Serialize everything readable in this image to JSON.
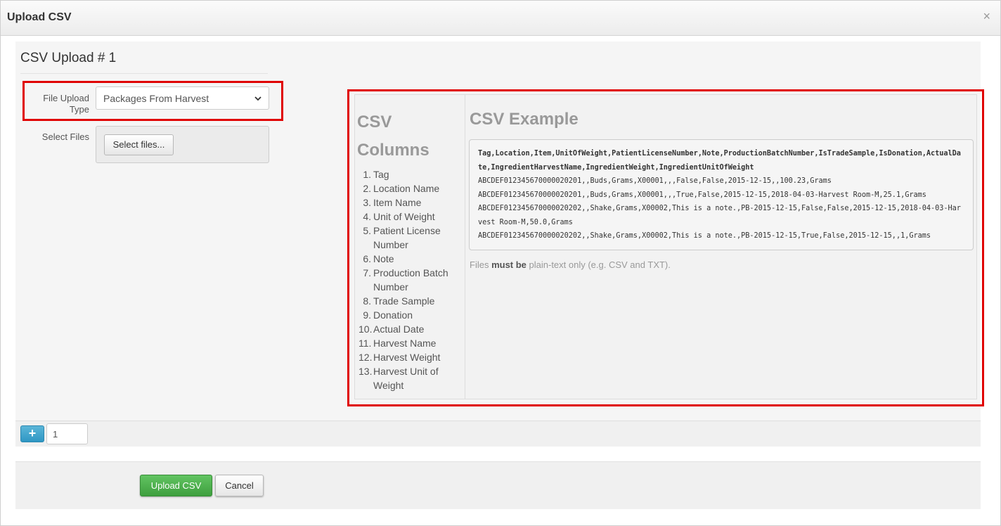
{
  "modal": {
    "title": "Upload CSV",
    "close_icon": "close-icon",
    "close_glyph": "×"
  },
  "upload": {
    "title": "CSV Upload # 1",
    "file_upload_type_label": "File Upload Type",
    "file_upload_type_value": "Packages From Harvest",
    "select_files_label": "Select Files",
    "select_files_button": "Select files...",
    "add_button_glyph": "+",
    "count_value": "1"
  },
  "columns": {
    "heading": "CSV Columns",
    "items": [
      {
        "num": "1.",
        "text": "Tag"
      },
      {
        "num": "2.",
        "text": "Location Name"
      },
      {
        "num": "3.",
        "text": "Item Name"
      },
      {
        "num": "4.",
        "text": "Unit of Weight"
      },
      {
        "num": "5.",
        "text": "Patient License Number"
      },
      {
        "num": "6.",
        "text": "Note"
      },
      {
        "num": "7.",
        "text": "Production Batch Number"
      },
      {
        "num": "8.",
        "text": "Trade Sample"
      },
      {
        "num": "9.",
        "text": "Donation"
      },
      {
        "num": "10.",
        "text": "Actual Date"
      },
      {
        "num": "11.",
        "text": "Harvest Name"
      },
      {
        "num": "12.",
        "text": "Harvest Weight"
      },
      {
        "num": "13.",
        "text": "Harvest Unit of Weight"
      }
    ]
  },
  "example": {
    "heading": "CSV Example",
    "header_line": "Tag,Location,Item,UnitOfWeight,PatientLicenseNumber,Note,ProductionBatchNumber,IsTradeSample,IsDonation,ActualDate,IngredientHarvestName,IngredientWeight,IngredientUnitOfWeight",
    "lines": [
      "ABCDEF012345670000020201,,Buds,Grams,X00001,,,False,False,2015-12-15,,100.23,Grams",
      "ABCDEF012345670000020201,,Buds,Grams,X00001,,,True,False,2015-12-15,2018-04-03-Harvest Room-M,25.1,Grams",
      "ABCDEF012345670000020202,,Shake,Grams,X00002,This is a note.,PB-2015-12-15,False,False,2015-12-15,2018-04-03-Harvest Room-M,50.0,Grams",
      "ABCDEF012345670000020202,,Shake,Grams,X00002,This is a note.,PB-2015-12-15,True,False,2015-12-15,,1,Grams"
    ],
    "note_prefix": "Files ",
    "note_bold": "must be",
    "note_suffix": " plain-text only (e.g. CSV and TXT)."
  },
  "footer": {
    "upload_button": "Upload CSV",
    "cancel_button": "Cancel"
  },
  "colors": {
    "highlight": "#e00000",
    "upload_button": "#4cae4c",
    "add_button": "#3aa0cb",
    "heading_gray": "#999999"
  }
}
